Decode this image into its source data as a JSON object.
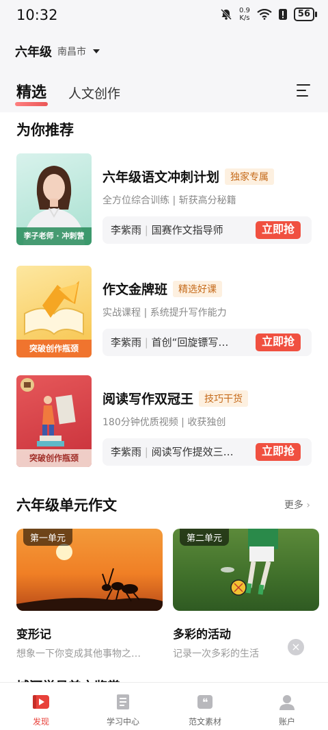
{
  "status_bar": {
    "time": "10:32",
    "net_speed_value": "0.9",
    "net_speed_unit": "K/s",
    "battery": "56"
  },
  "header": {
    "grade": "六年级",
    "city": "南昌市"
  },
  "tabs": [
    {
      "label": "精选",
      "active": true
    },
    {
      "label": "人文创作",
      "active": false
    }
  ],
  "recommend": {
    "title": "为你推荐",
    "courses": [
      {
        "thumb_caption": "李子老师 · 冲刺营",
        "title": "六年级语文冲刺计划",
        "badge": "独家专属",
        "subtitle": "全方位综合训练 | 斩获高分秘籍",
        "teacher": "李紫雨",
        "teacher_desc": "国赛作文指导师",
        "button": "立即抢"
      },
      {
        "thumb_caption": "突破创作瓶颈",
        "title": "作文金牌班",
        "badge": "精选好课",
        "subtitle": "实战课程 | 系统提升写作能力",
        "teacher": "李紫雨",
        "teacher_desc": "首创“回旋镖写…",
        "button": "立即抢"
      },
      {
        "thumb_caption": "突破创作瓶颈",
        "title": "阅读写作双冠王",
        "badge": "技巧干货",
        "subtitle": "180分钟优质视频 | 收获独创",
        "teacher": "李紫雨",
        "teacher_desc": "阅读写作提效三…",
        "button": "立即抢"
      }
    ]
  },
  "units": {
    "title": "六年级单元作文",
    "more": "更多",
    "items": [
      {
        "tag": "第一单元",
        "title": "变形记",
        "desc": "想象一下你变成其他事物之…"
      },
      {
        "tag": "第二单元",
        "title": "多彩的活动",
        "desc": "记录一次多彩的生活"
      }
    ]
  },
  "next_section_peek": "城河学员美文鉴赏",
  "bottom_nav": [
    {
      "label": "发现",
      "icon": "video-play-icon",
      "active": true
    },
    {
      "label": "学习中心",
      "icon": "book-icon",
      "active": false
    },
    {
      "label": "范文素材",
      "icon": "quote-icon",
      "active": false
    },
    {
      "label": "账户",
      "icon": "user-icon",
      "active": false
    }
  ],
  "colors": {
    "accent": "#f05040",
    "badge_text": "#c56a1a",
    "badge_bg": "#fdf0e0"
  }
}
